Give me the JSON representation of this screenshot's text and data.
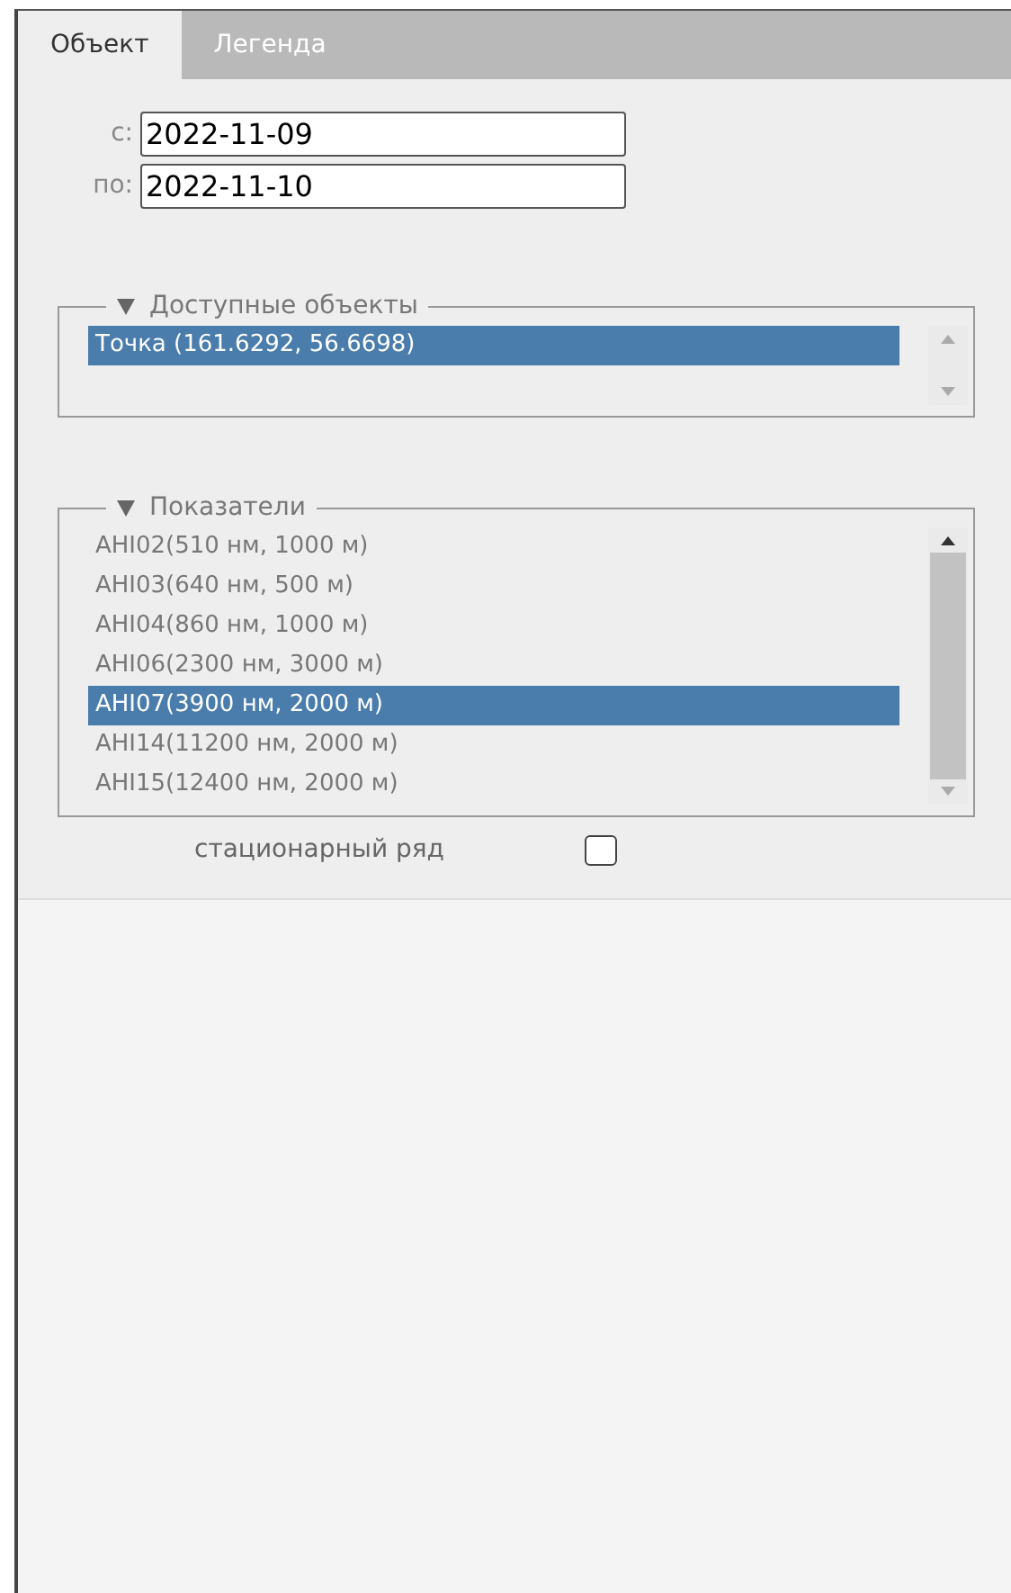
{
  "tabs": [
    {
      "label": "Объект",
      "selected": true
    },
    {
      "label": "Легенда",
      "selected": false
    }
  ],
  "date_fields": [
    {
      "label": "с:",
      "value": "2022-11-09"
    },
    {
      "label": "по:",
      "value": "2022-11-10"
    }
  ],
  "groups": [
    {
      "title": "Доступные объекты",
      "items": [
        {
          "label": "Точка (161.6292, 56.6698)",
          "selected": true
        }
      ]
    },
    {
      "title": "Показатели",
      "items": [
        {
          "label": "AHI02(510 нм, 1000 м)",
          "selected": false
        },
        {
          "label": "AHI03(640 нм, 500 м)",
          "selected": false
        },
        {
          "label": "AHI04(860 нм, 1000 м)",
          "selected": false
        },
        {
          "label": "AHI06(2300 нм, 3000 м)",
          "selected": false
        },
        {
          "label": "AHI07(3900 нм, 2000 м)",
          "selected": true
        },
        {
          "label": "AHI14(11200 нм, 2000 м)",
          "selected": false
        },
        {
          "label": "AHI15(12400 нм, 2000 м)",
          "selected": false
        }
      ]
    }
  ],
  "stationary": {
    "label": "стационарный ряд",
    "checked": false
  }
}
